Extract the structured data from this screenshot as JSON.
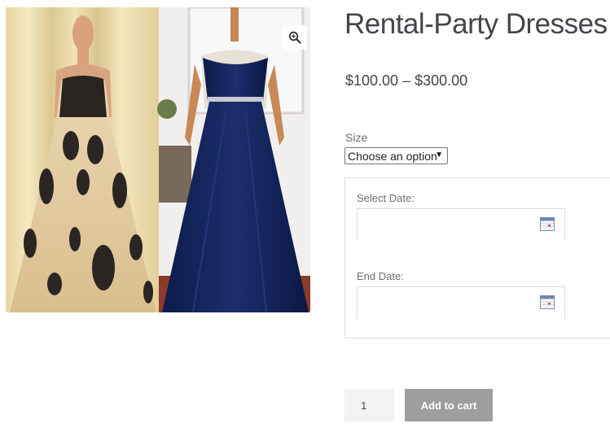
{
  "product": {
    "title": "Rental-Party Dresses",
    "price_range": "$100.00 – $300.00",
    "image": {
      "zoom_icon": "zoom-in-icon"
    }
  },
  "variations": {
    "size_label": "Size",
    "size_selected": "Choose an option"
  },
  "booking": {
    "start_label": "Select Date:",
    "start_value": "",
    "end_label": "End Date:",
    "end_value": "",
    "calendar_icon": "calendar-icon"
  },
  "cart": {
    "quantity": "1",
    "add_to_cart_label": "Add to cart",
    "button_color": "#9e9e9e"
  }
}
